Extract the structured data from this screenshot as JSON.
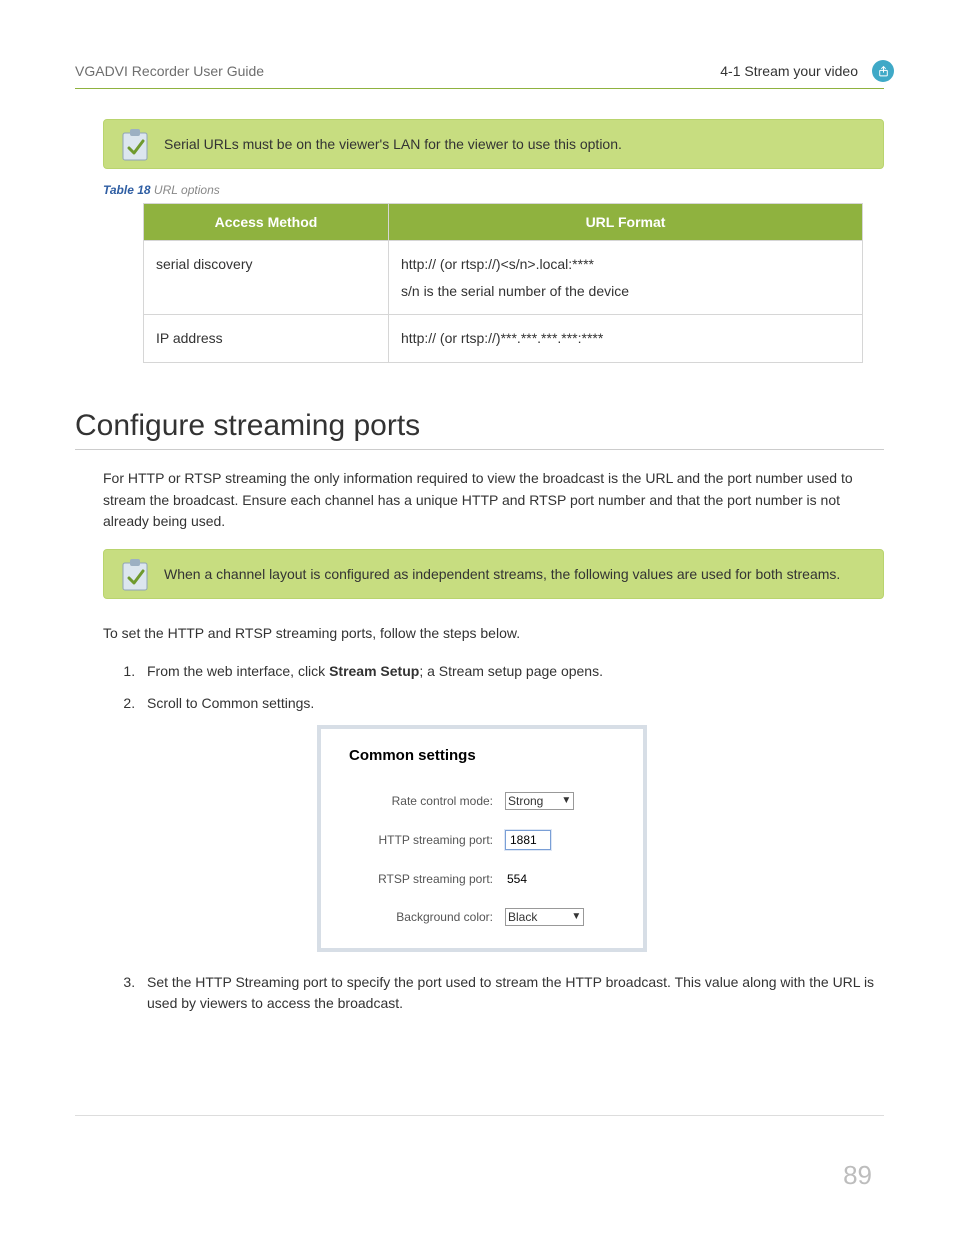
{
  "header": {
    "left": "VGADVI Recorder User Guide",
    "right": "4-1 Stream your video"
  },
  "note1": "Serial URLs must be on the viewer's LAN for the viewer to use this option.",
  "table": {
    "caption_label": "Table 18",
    "caption_desc": "URL options",
    "head": {
      "col1": "Access Method",
      "col2": "URL Format"
    },
    "rows": [
      {
        "c1": "serial discovery",
        "c2": "http:// (or rtsp://)<s/n>.local:****\ns/n is the serial number of the device"
      },
      {
        "c1": "IP address",
        "c2": "http:// (or rtsp://)***.***.***.***:****"
      }
    ]
  },
  "section_title": "Configure streaming ports",
  "para1": "For HTTP or RTSP streaming the only information required to view the broadcast is the URL and the port number used to stream the broadcast. Ensure each channel has a unique HTTP and RTSP port number and that the port number is not already being used.",
  "note2": "When a channel layout is configured as independent streams, the following values are used for both streams.",
  "para2": "To set the HTTP and RTSP streaming ports, follow the steps below.",
  "steps": {
    "s1_pre": "From the web interface, click ",
    "s1_bold": "Stream Setup",
    "s1_post": "; a Stream setup page opens.",
    "s2": "Scroll to Common settings.",
    "s3": "Set the HTTP Streaming port to specify the port used to stream the HTTP broadcast. This value along with the URL is used by viewers to access the broadcast."
  },
  "settings": {
    "title": "Common settings",
    "rate_label": "Rate control mode:",
    "rate_value": "Strong",
    "http_label": "HTTP streaming port:",
    "http_value": "1881",
    "rtsp_label": "RTSP streaming port:",
    "rtsp_value": "554",
    "bg_label": "Background color:",
    "bg_value": "Black"
  },
  "page_number": "89"
}
